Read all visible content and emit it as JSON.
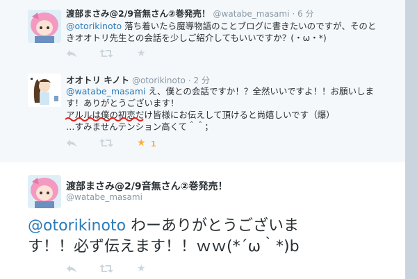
{
  "tweets": [
    {
      "name": "渡部まさみ@2/9音無さん②巻発売！",
      "handle": "@watabe_masami",
      "time": "· 6 分",
      "mention": "@otorikinoto",
      "line1": " 落ち着いたら魔導物語のことブログに書きたいのですが、そのと",
      "line2": "きオオトリ先生との会話を少しご紹介してもいいですか？(・ω・*)"
    },
    {
      "name": "オオトリ キノト",
      "handle": "@otorikinoto",
      "time": "· 2 分",
      "mention": "@watabe_masami",
      "line1": " え、僕との会話ですか！？全然いいですよ！！お願いしま",
      "line2": "す！ありがとうございます！",
      "line3": "アルルは僕の初恋だけ皆様にお伝えして頂けると尚嬉しいです（爆）",
      "line4": "…すみませんテンション高くて＾＾；",
      "fav_count": "1"
    },
    {
      "name": "渡部まさみ@2/9音無さん②巻発売！",
      "handle": "@watabe_masami",
      "mention": "@otorikinoto",
      "line1": " わーありがとうございま",
      "line2": "す！！必ず伝えます！！ｗｗ(*´ω｀*)b"
    }
  ],
  "icons": {
    "reply": "reply-icon",
    "retweet": "retweet-icon",
    "favorite": "star-icon"
  },
  "colors": {
    "link": "#2b7bb9",
    "muted": "#8899a6",
    "fav_active": "#ffac33",
    "annotation": "#e0201a"
  }
}
